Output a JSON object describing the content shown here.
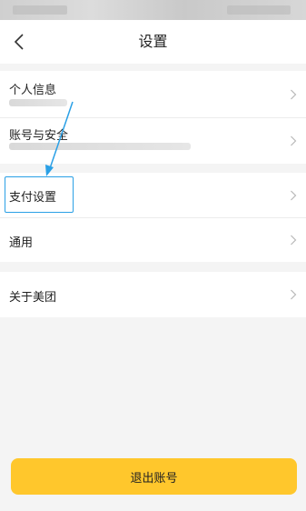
{
  "header": {
    "title": "设置",
    "back_icon": "chevron-left-icon"
  },
  "groups": [
    {
      "items": [
        {
          "label": "个人信息",
          "icon": "chevron-right-icon"
        },
        {
          "label": "账号与安全",
          "icon": "chevron-right-icon"
        }
      ]
    },
    {
      "items": [
        {
          "label": "支付设置",
          "icon": "chevron-right-icon",
          "highlighted": true
        },
        {
          "label": "通用",
          "icon": "chevron-right-icon"
        }
      ]
    },
    {
      "items": [
        {
          "label": "关于美团",
          "icon": "chevron-right-icon"
        }
      ]
    }
  ],
  "footer": {
    "logout_label": "退出账号"
  },
  "colors": {
    "accent": "#ffc72c",
    "highlight": "#2aa0e6",
    "background": "#f4f4f4"
  }
}
